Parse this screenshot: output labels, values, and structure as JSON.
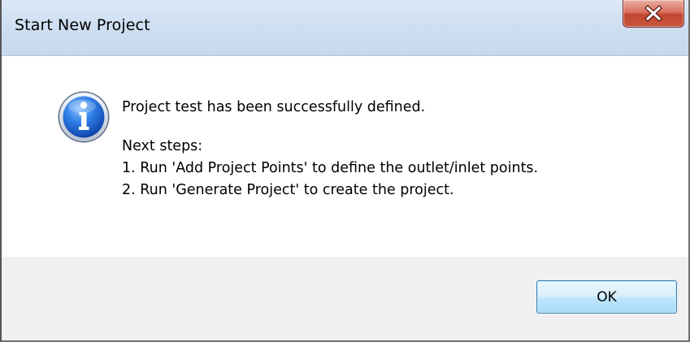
{
  "dialog": {
    "title": "Start New Project",
    "close_symbol": "X"
  },
  "icon": "info-icon",
  "message": {
    "headline": "Project test has been successfully defined.",
    "next_steps_label": "Next steps:",
    "steps": [
      "1. Run 'Add Project Points' to define the outlet/inlet points.",
      "2. Run 'Generate Project' to create the project."
    ]
  },
  "buttons": {
    "ok_label": "OK"
  },
  "colors": {
    "titlebar": "#cfdff2",
    "close_button": "#c24630",
    "content_background": "#ffffff",
    "footer_background": "#f0f0f0",
    "ok_button_border": "#3c7fb1"
  }
}
